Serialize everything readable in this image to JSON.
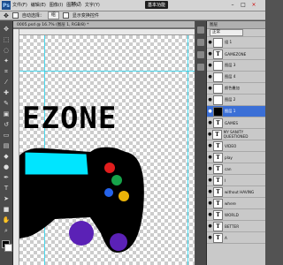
{
  "menubar": {
    "logo": "Ps",
    "items": [
      "文件(F)",
      "编辑(E)",
      "图像(I)",
      "图层(L)",
      "文字(Y)"
    ],
    "zoom": "16.7",
    "workspace": "基本功能",
    "win_controls": [
      "–",
      "□",
      "×"
    ]
  },
  "options": {
    "auto_select": "自动选择：",
    "group_value": "组",
    "show_transform": "显示变换控件"
  },
  "document": {
    "tab": "0005.psd @ 16.7% (图层 1, RGB/8) *",
    "canvas_text": "EZONE"
  },
  "layers": {
    "header": "图层",
    "blend_mode": "正常",
    "rows": [
      {
        "name": "组 1",
        "thumb": "",
        "eye": "●",
        "selected": false
      },
      {
        "name": "GAMEZONE",
        "thumb": "T",
        "eye": "●",
        "selected": false
      },
      {
        "name": "图层 3",
        "thumb": "",
        "eye": "●",
        "selected": false
      },
      {
        "name": "图层 4",
        "thumb": "",
        "eye": "●",
        "selected": false
      },
      {
        "name": "颜色叠加",
        "thumb": "",
        "eye": "●",
        "selected": false
      },
      {
        "name": "图层 2",
        "thumb": "",
        "eye": "●",
        "selected": false
      },
      {
        "name": "图层 1",
        "thumb": "",
        "eye": "●",
        "selected": true
      },
      {
        "name": "GAMES",
        "thumb": "T",
        "eye": "●",
        "selected": false
      },
      {
        "name": "MY SANITY QUESTIONED",
        "thumb": "T",
        "eye": "●",
        "selected": false
      },
      {
        "name": "VIDEO",
        "thumb": "T",
        "eye": "●",
        "selected": false
      },
      {
        "name": "play",
        "thumb": "T",
        "eye": "●",
        "selected": false
      },
      {
        "name": "can",
        "thumb": "T",
        "eye": "●",
        "selected": false
      },
      {
        "name": "I",
        "thumb": "T",
        "eye": "●",
        "selected": false
      },
      {
        "name": "without HAVING",
        "thumb": "T",
        "eye": "●",
        "selected": false
      },
      {
        "name": "where",
        "thumb": "T",
        "eye": "●",
        "selected": false
      },
      {
        "name": "WORLD",
        "thumb": "T",
        "eye": "●",
        "selected": false
      },
      {
        "name": "BETTER",
        "thumb": "T",
        "eye": "●",
        "selected": false
      },
      {
        "name": "A",
        "thumb": "T",
        "eye": "●",
        "selected": false
      }
    ]
  },
  "colors": {
    "accent_selected": "#3b6fd6",
    "controller_body": "#000000",
    "controller_screen": "#00e5ff",
    "button_red": "#e11d1d",
    "button_green": "#16a34a",
    "button_yellow": "#eab308",
    "button_blue": "#2563eb",
    "grip_purple": "#5b21b6"
  }
}
